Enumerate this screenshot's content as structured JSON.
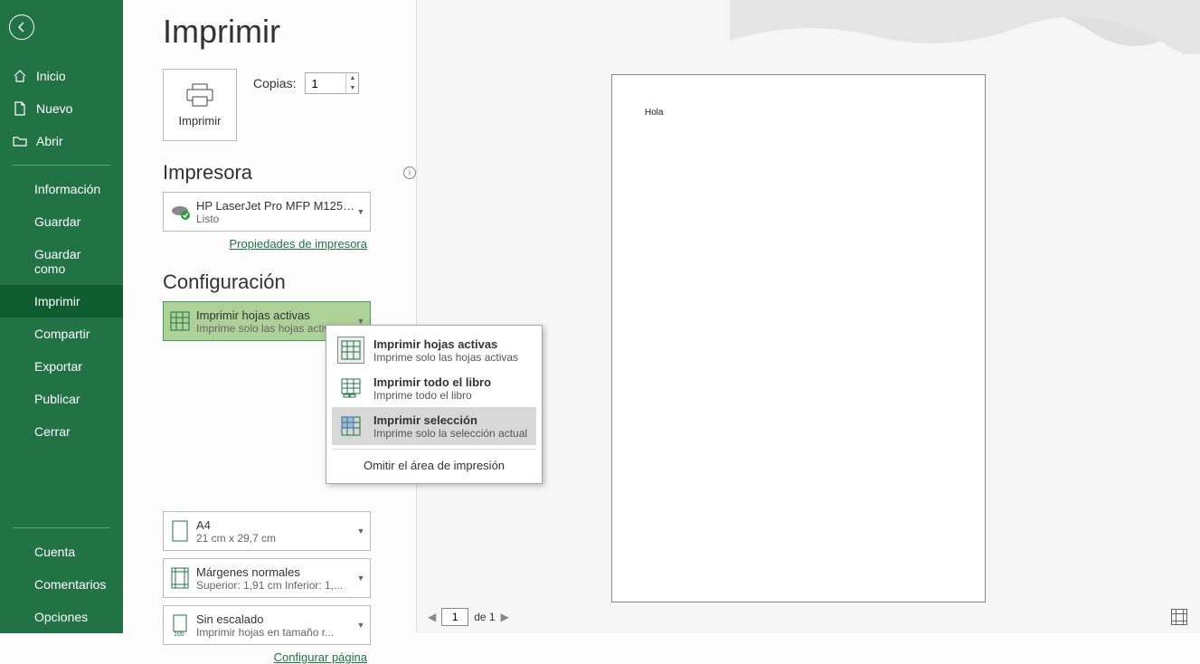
{
  "sidebar": {
    "top": [
      {
        "label": "Inicio"
      },
      {
        "label": "Nuevo"
      },
      {
        "label": "Abrir"
      }
    ],
    "mid": [
      {
        "label": "Información"
      },
      {
        "label": "Guardar"
      },
      {
        "label": "Guardar como"
      },
      {
        "label": "Imprimir",
        "active": true
      },
      {
        "label": "Compartir"
      },
      {
        "label": "Exportar"
      },
      {
        "label": "Publicar"
      },
      {
        "label": "Cerrar"
      }
    ],
    "bottom": [
      {
        "label": "Cuenta"
      },
      {
        "label": "Comentarios"
      },
      {
        "label": "Opciones"
      }
    ]
  },
  "print": {
    "title": "Imprimir",
    "button_label": "Imprimir",
    "copies_label": "Copias:",
    "copies_value": "1",
    "printer_section": "Impresora",
    "printer_name": "HP LaserJet Pro MFP M125-...",
    "printer_status": "Listo",
    "printer_props_link": "Propiedades de impresora",
    "config_section": "Configuración",
    "what_dd": {
      "t1": "Imprimir hojas activas",
      "t2": "Imprime solo las hojas activas"
    },
    "config_page_link": "Configurar página",
    "dd_options": [
      {
        "t1": "Imprimir hojas activas",
        "t2": "Imprime solo las hojas activas",
        "selected": true
      },
      {
        "t1": "Imprimir todo el libro",
        "t2": "Imprime todo el libro"
      },
      {
        "t1": "Imprimir selección",
        "t2": "Imprime solo la selección actual",
        "hover": true
      }
    ],
    "dd_footer": "Omitir el área de impresión",
    "paper_dd": {
      "t1": "A4",
      "t2": "21 cm x 29,7 cm"
    },
    "margin_dd": {
      "t1": "Márgenes normales",
      "t2": "Superior: 1,91 cm Inferior: 1,..."
    },
    "scale_dd": {
      "t1": "Sin escalado",
      "t2": "Imprimir hojas en tamaño r..."
    },
    "preview_content": "Hola",
    "page_nav": {
      "page": "1",
      "of": "de 1"
    }
  }
}
